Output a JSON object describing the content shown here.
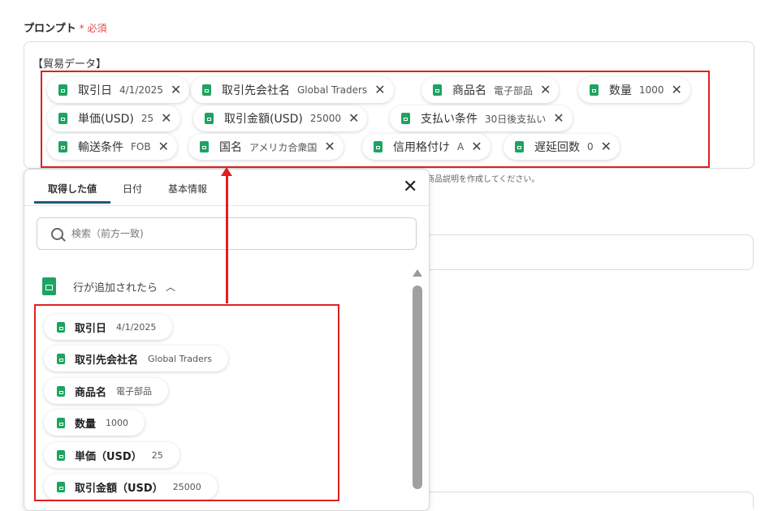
{
  "field": {
    "label": "プロンプト",
    "asterisk": "*",
    "required": "必須"
  },
  "prompt": {
    "heading": "【貿易データ】",
    "tokens": [
      {
        "label": "取引日",
        "value": "4/1/2025"
      },
      {
        "label": "取引先会社名",
        "value": "Global Traders"
      },
      {
        "label": "商品名",
        "value": "電子部品"
      },
      {
        "label": "数量",
        "value": "1000"
      },
      {
        "label": "単価(USD)",
        "value": "25"
      },
      {
        "label": "取引金額(USD)",
        "value": "25000"
      },
      {
        "label": "支払い条件",
        "value": "30日後支払い"
      },
      {
        "label": "輸送条件",
        "value": "FOB"
      },
      {
        "label": "国名",
        "value": "アメリカ合衆国"
      },
      {
        "label": "信用格付け",
        "value": "A"
      },
      {
        "label": "遅延回数",
        "value": "0"
      }
    ],
    "helper_text": "商品説明を作成してください。"
  },
  "popup": {
    "tabs": [
      {
        "label": "取得した値",
        "active": true
      },
      {
        "label": "日付",
        "active": false
      },
      {
        "label": "基本情報",
        "active": false
      }
    ],
    "search_placeholder": "検索（前方一致)",
    "section_title": "行が追加されたら",
    "items": [
      {
        "label": "取引日",
        "value": "4/1/2025"
      },
      {
        "label": "取引先会社名",
        "value": "Global Traders"
      },
      {
        "label": "商品名",
        "value": "電子部品"
      },
      {
        "label": "数量",
        "value": "1000"
      },
      {
        "label": "単価（USD）",
        "value": "25"
      },
      {
        "label": "取引金額（USD）",
        "value": "25000"
      }
    ]
  },
  "icons": {
    "sheet": "google-sheets-icon",
    "remove": "close-icon",
    "search": "search-icon",
    "collapse": "chevron-up-icon"
  },
  "colors": {
    "sheet_green": "#1ea362",
    "highlight_red": "#e02020",
    "required_red": "#e5484d",
    "tab_underline": "#1e5a7a"
  }
}
